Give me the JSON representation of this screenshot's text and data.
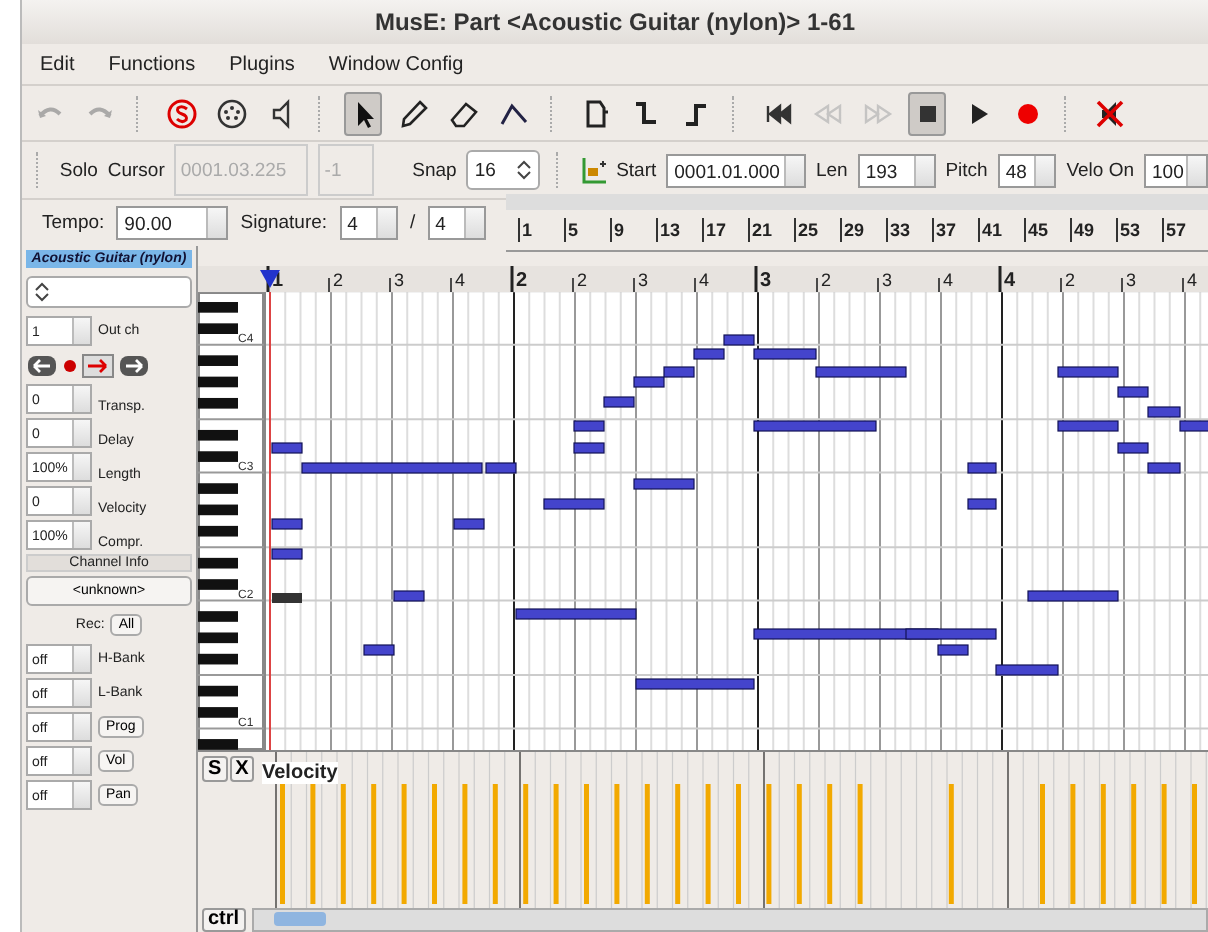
{
  "window": {
    "title": "MusE: Part <Acoustic Guitar (nylon)> 1-61"
  },
  "menu": [
    "Edit",
    "Functions",
    "Plugins",
    "Window Config"
  ],
  "toolbar": [
    {
      "kind": "undo",
      "disabled": true
    },
    {
      "kind": "redo",
      "disabled": true
    },
    {
      "kind": "sep"
    },
    {
      "kind": "solo-s",
      "selected": false
    },
    {
      "kind": "midi",
      "selected": false
    },
    {
      "kind": "speaker",
      "selected": false
    },
    {
      "kind": "sep"
    },
    {
      "kind": "pointer",
      "selected": true
    },
    {
      "kind": "pencil",
      "selected": false
    },
    {
      "kind": "eraser",
      "selected": false
    },
    {
      "kind": "line",
      "selected": false
    },
    {
      "kind": "sep"
    },
    {
      "kind": "step1",
      "selected": false
    },
    {
      "kind": "step2",
      "selected": false
    },
    {
      "kind": "step3",
      "selected": false
    },
    {
      "kind": "sep"
    },
    {
      "kind": "to-start",
      "disabled": false
    },
    {
      "kind": "rewind",
      "disabled": true
    },
    {
      "kind": "forward",
      "disabled": true
    },
    {
      "kind": "stop",
      "selected": true
    },
    {
      "kind": "play",
      "selected": false
    },
    {
      "kind": "record",
      "selected": false
    },
    {
      "kind": "sep"
    },
    {
      "kind": "panic",
      "selected": false
    }
  ],
  "infobar": {
    "solo": "Solo",
    "cursor_label": "Cursor",
    "cursor": "0001.03.225",
    "cursor_pitch": "-1",
    "snap_label": "Snap",
    "snap": "16",
    "start_label": "Start",
    "start": "0001.01.000",
    "len_label": "Len",
    "len": "193",
    "pitch_label": "Pitch",
    "pitch": "48",
    "velo_label": "Velo On",
    "velo": "100"
  },
  "tempo_bar": {
    "tempo_label": "Tempo:",
    "tempo": "90.00",
    "signature_label": "Signature:",
    "sig_num": "4",
    "sig_sep": "/",
    "sig_den": "4",
    "overview_marks": [
      "1",
      "5",
      "9",
      "13",
      "17",
      "21",
      "25",
      "29",
      "33",
      "37",
      "41",
      "45",
      "49",
      "53",
      "57"
    ]
  },
  "track_panel": {
    "track_name": "Acoustic Guitar (nylon)",
    "spins": [
      {
        "value": "1",
        "label": "Out ch"
      }
    ],
    "spins2": [
      {
        "value": "0",
        "label": "Transp."
      },
      {
        "value": "0",
        "label": "Delay"
      },
      {
        "value": "100%",
        "label": "Length"
      },
      {
        "value": "0",
        "label": "Velocity"
      },
      {
        "value": "100%",
        "label": "Compr."
      }
    ],
    "channel_info": "Channel Info",
    "instrument": "<unknown>",
    "rec_label": "Rec:",
    "rec_button": "All",
    "controllers": [
      {
        "value": "off",
        "label": "H-Bank",
        "kind": "label"
      },
      {
        "value": "off",
        "label": "L-Bank",
        "kind": "label"
      },
      {
        "value": "off",
        "label": "Prog",
        "kind": "button"
      },
      {
        "value": "off",
        "label": "Vol",
        "kind": "button"
      },
      {
        "value": "off",
        "label": "Pan",
        "kind": "button"
      }
    ]
  },
  "ruler": {
    "marks": [
      {
        "label": "1",
        "bar": true
      },
      {
        "label": "2",
        "bar": false
      },
      {
        "label": "3",
        "bar": false
      },
      {
        "label": "4",
        "bar": false
      },
      {
        "label": "2",
        "bar": true
      },
      {
        "label": "2",
        "bar": false
      },
      {
        "label": "3",
        "bar": false
      },
      {
        "label": "4",
        "bar": false
      },
      {
        "label": "3",
        "bar": true
      },
      {
        "label": "2",
        "bar": false
      },
      {
        "label": "3",
        "bar": false
      },
      {
        "label": "4",
        "bar": false
      },
      {
        "label": "4",
        "bar": true
      },
      {
        "label": "2",
        "bar": false
      },
      {
        "label": "3",
        "bar": false
      },
      {
        "label": "4",
        "bar": false
      }
    ]
  },
  "keyboard": {
    "octave_labels": [
      "C4",
      "C3",
      "C2",
      "C1"
    ]
  },
  "controller_lane": {
    "solo": "S",
    "close": "X",
    "name": "Velocity",
    "ctrl_button": "ctrl"
  }
}
